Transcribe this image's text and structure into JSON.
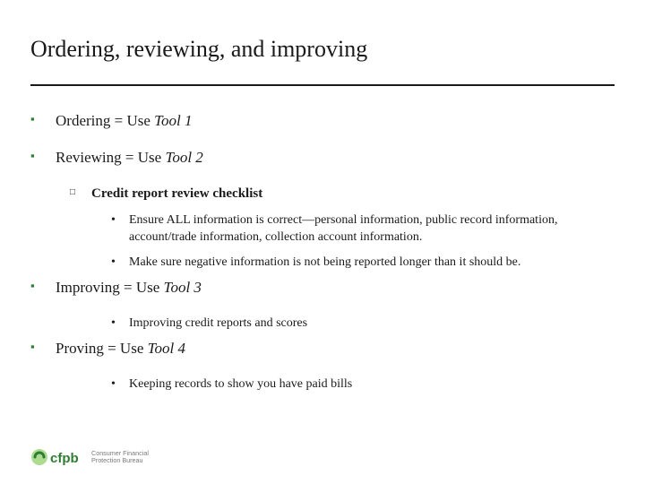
{
  "title": "Ordering, reviewing, and improving",
  "items": [
    {
      "prefix": "Ordering = Use ",
      "tool": "Tool 1",
      "sub": null,
      "points": []
    },
    {
      "prefix": "Reviewing = Use ",
      "tool": "Tool 2",
      "sub": "Credit report review checklist",
      "points": [
        "Ensure ALL information is correct—personal information, public record information, account/trade information, collection account information.",
        "Make sure negative information is not being reported longer than it should be."
      ]
    },
    {
      "prefix": "Improving = Use ",
      "tool": "Tool 3",
      "sub": null,
      "points": [
        "Improving credit reports and scores"
      ]
    },
    {
      "prefix": "Proving = Use ",
      "tool": "Tool 4",
      "sub": null,
      "points": [
        "Keeping records to show you have paid bills"
      ]
    }
  ],
  "logo": {
    "letters": "cfpb",
    "line1": "Consumer Financial",
    "line2": "Protection Bureau"
  },
  "colors": {
    "accent": "#2e7d32"
  }
}
